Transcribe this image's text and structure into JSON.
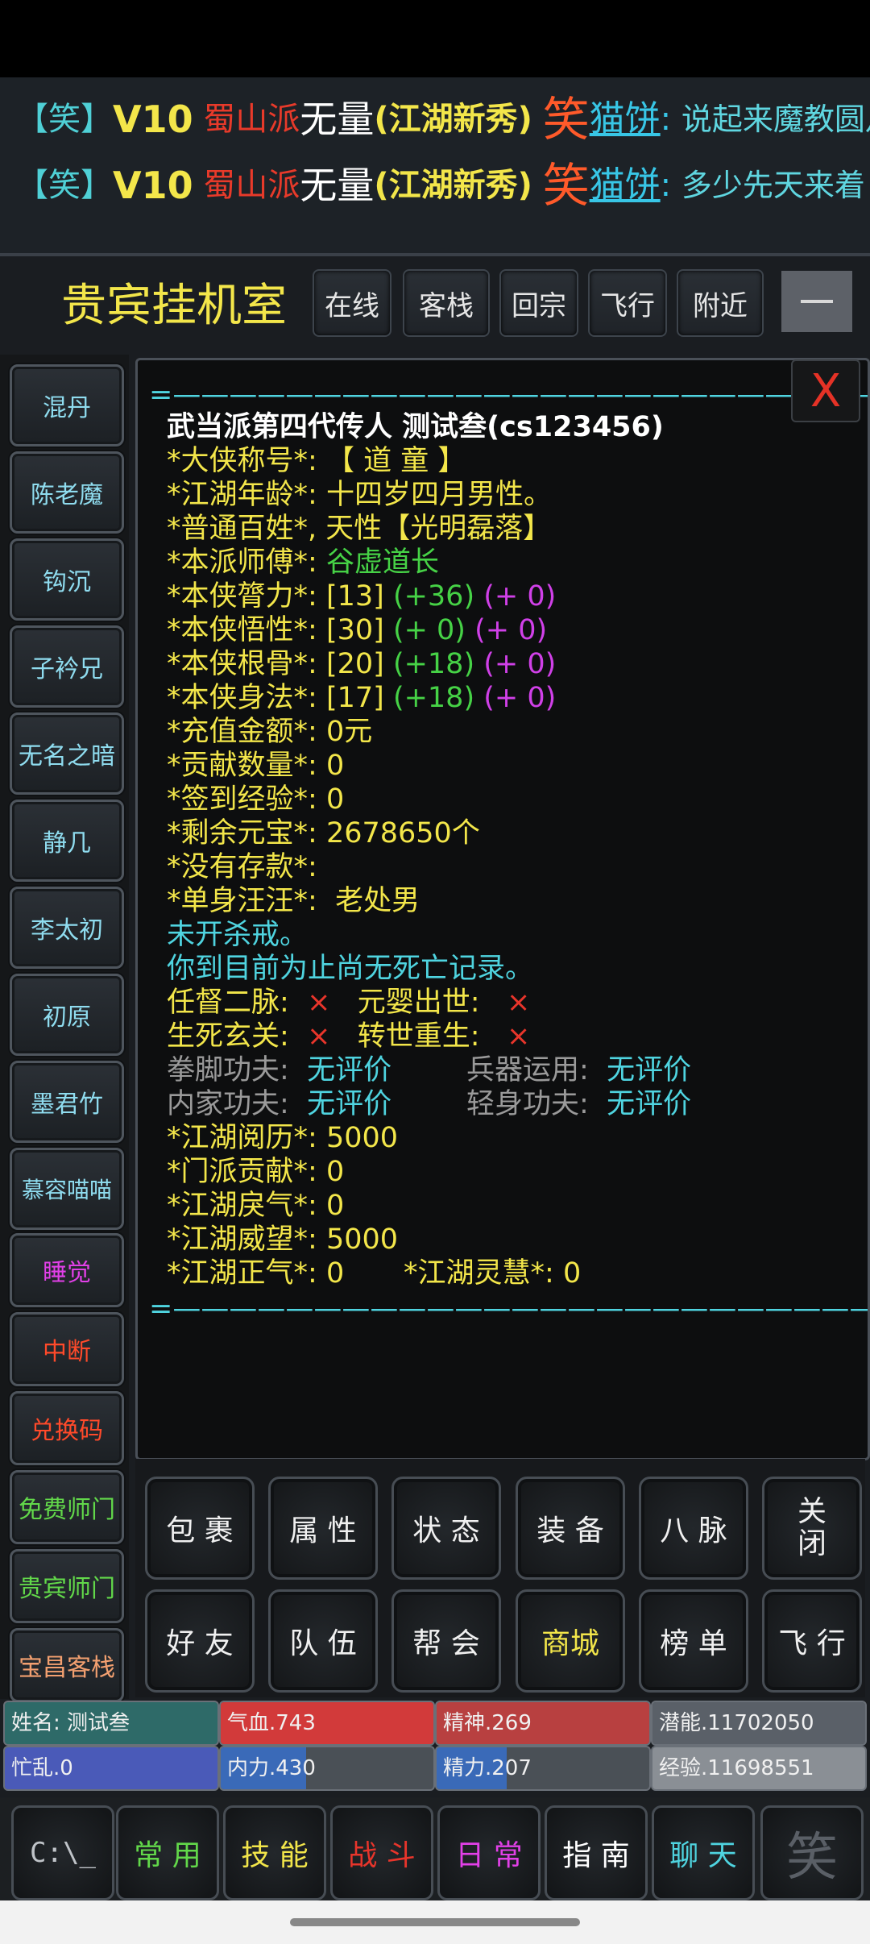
{
  "chat": [
    {
      "tag": "【笑】",
      "vip": "V10",
      "sect": "蜀山派",
      "name": "无量",
      "title": "(江湖新秀)",
      "xiao": "笑",
      "nick": "猫饼",
      "colon": ":",
      "msg": "说起来魔教圆月"
    },
    {
      "tag": "【笑】",
      "vip": "V10",
      "sect": "蜀山派",
      "name": "无量",
      "title": "(江湖新秀)",
      "xiao": "笑",
      "nick": "猫饼",
      "colon": ":",
      "msg": "多少先天来着"
    }
  ],
  "header": {
    "room_title": "贵宾挂机室",
    "nav": [
      "在线",
      "客栈",
      "回宗",
      "飞行",
      "附近"
    ]
  },
  "sidebar": [
    "混丹",
    "陈老魔",
    "钩沉",
    "子衿兄",
    "无名之暗",
    "静几",
    "李太初",
    "初原",
    "墨君竹",
    "慕容喵喵",
    "睡觉",
    "中断",
    "兑换码",
    "免费师门",
    "贵宾师门",
    "宝昌客栈"
  ],
  "panel": {
    "close": "X",
    "border_line": "=——————————————————————————=",
    "heading": "武当派第四代传人 测试叁(cs123456)",
    "nickname_label": "*大侠称号*:",
    "nickname_value": "【 道 童 】",
    "age_label": "*江湖年龄*:",
    "age_value": "十四岁四月男性。",
    "people_label": "*普通百姓*,",
    "people_value": "天性【光明磊落】",
    "master_label": "*本派师傅*:",
    "master_value": "谷虚道长",
    "str_label": "*本侠膂力*:",
    "str_base": "[13]",
    "str_bonus": "(+36)",
    "str_extra": "(+ 0)",
    "int_label": "*本侠悟性*:",
    "int_base": "[30]",
    "int_bonus": "(+ 0)",
    "int_extra": "(+ 0)",
    "con_label": "*本侠根骨*:",
    "con_base": "[20]",
    "con_bonus": "(+18)",
    "con_extra": "(+ 0)",
    "dex_label": "*本侠身法*:",
    "dex_base": "[17]",
    "dex_bonus": "(+18)",
    "dex_extra": "(+ 0)",
    "recharge_label": "*充值金额*:",
    "recharge_value": "0元",
    "contrib_label": "*贡献数量*:",
    "contrib_value": "0",
    "signin_label": "*签到经验*:",
    "signin_value": "0",
    "yuanbao_label": "*剩余元宝*:",
    "yuanbao_value": "2678650个",
    "deposit_label": "*没有存款*:",
    "single_label": "*单身汪汪*:",
    "single_value": "老处男",
    "kill_text": "未开杀戒。",
    "death_text": "你到目前为止尚无死亡记录。",
    "meridian_label": "任督二脉:",
    "meridian_value": "×",
    "yuanying_label": "元婴出世:",
    "yuanying_value": "×",
    "shengsi_label": "生死玄关:",
    "shengsi_value": "×",
    "rebirth_label": "转世重生:",
    "rebirth_value": "×",
    "fist_label": "拳脚功夫:",
    "fist_value": "无评价",
    "weapon_label": "兵器运用:",
    "weapon_value": "无评价",
    "inner_label": "内家功夫:",
    "inner_value": "无评价",
    "light_label": "轻身功夫:",
    "light_value": "无评价",
    "exp_label": "*江湖阅历*:",
    "exp_value": "5000",
    "sect_contrib_label": "*门派贡献*:",
    "sect_contrib_value": "0",
    "evil_label": "*江湖戾气*:",
    "evil_value": "0",
    "prestige_label": "*江湖威望*:",
    "prestige_value": "5000",
    "righteous_label": "*江湖正气*:",
    "righteous_value": "0",
    "wisdom_label": "*江湖灵慧*:",
    "wisdom_value": "0"
  },
  "actions_row1": [
    "包 裹",
    "属 性",
    "状 态",
    "装 备",
    "八 脉",
    "关\n闭"
  ],
  "actions_row2": [
    "好 友",
    "队 伍",
    "帮 会",
    "商城",
    "榜 单",
    "飞 行"
  ],
  "stats": {
    "name": "姓名: 测试叁",
    "hp": "气血.743",
    "spirit": "精神.269",
    "potential": "潜能.11702050",
    "busy": "忙乱.0",
    "neili": "内力.430",
    "jingli": "精力.207",
    "exp": "经验.11698551",
    "hp_level": 1.0,
    "spirit_level": 1.0,
    "neili_level": 0.4,
    "jingli_level": 0.33,
    "busy_level": 1.0,
    "colors": {
      "name": "#2e6a68",
      "hp": "#d23a3a",
      "spirit": "#b84040",
      "potential": "#5a6068",
      "busy": "#4a5ab8",
      "neili": "#3a6ab8",
      "jingli": "#3a6ab8",
      "exp": "#8a8f95"
    }
  },
  "bottom": {
    "console_icon": "C:\\_",
    "tabs": [
      "常 用",
      "技 能",
      "战 斗",
      "日 常",
      "指 南",
      "聊 天"
    ],
    "tab_colors": [
      "#62d84a",
      "#f3e64a",
      "#e8352b",
      "#e240e8",
      "#ffffff",
      "#4fd4e0"
    ],
    "logo_char": "笑"
  }
}
